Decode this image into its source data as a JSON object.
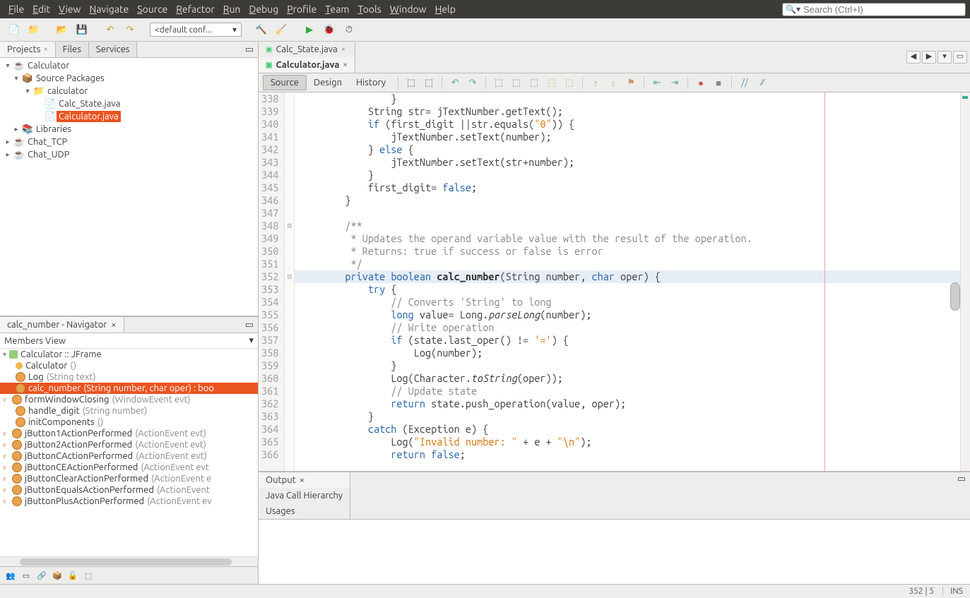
{
  "menubar": [
    "File",
    "Edit",
    "View",
    "Navigate",
    "Source",
    "Refactor",
    "Run",
    "Debug",
    "Profile",
    "Team",
    "Tools",
    "Window",
    "Help"
  ],
  "search_placeholder": "Search (Ctrl+I)",
  "config_select": "<default conf...",
  "left_tabs": [
    {
      "label": "Projects",
      "active": true,
      "close": true
    },
    {
      "label": "Files",
      "active": false,
      "close": false
    },
    {
      "label": "Services",
      "active": false,
      "close": false
    }
  ],
  "projects_tree": [
    {
      "indent": 0,
      "exp": "▾",
      "icon": "☕",
      "label": "Calculator"
    },
    {
      "indent": 1,
      "exp": "▾",
      "icon": "📦",
      "label": "Source Packages"
    },
    {
      "indent": 2,
      "exp": "▾",
      "icon": "📁",
      "label": "calculator"
    },
    {
      "indent": 3,
      "exp": "",
      "icon": "📄",
      "label": "Calc_State.java"
    },
    {
      "indent": 3,
      "exp": "",
      "icon": "📄",
      "label": "Calculator.java",
      "selected": true
    },
    {
      "indent": 1,
      "exp": "▸",
      "icon": "📚",
      "label": "Libraries"
    },
    {
      "indent": 0,
      "exp": "▸",
      "icon": "☕",
      "label": "Chat_TCP"
    },
    {
      "indent": 0,
      "exp": "▸",
      "icon": "☕",
      "label": "Chat_UDP"
    }
  ],
  "navigator_title": "calc_number - Navigator",
  "members_view": "Members View",
  "nav_class": "Calculator :: JFrame",
  "nav_items": [
    {
      "icon": "diamond",
      "name": "Calculator",
      "params": "()"
    },
    {
      "icon": "orange",
      "name": "Log",
      "params": "(String text)"
    },
    {
      "icon": "orange",
      "name": "calc_number",
      "params": "(String number, char oper) : boo",
      "selected": true
    },
    {
      "icon": "orange",
      "name": "formWindowClosing",
      "params": "(WindowEvent evt)",
      "e": true
    },
    {
      "icon": "orange",
      "name": "handle_digit",
      "params": "(String number)"
    },
    {
      "icon": "orange",
      "name": "initComponents",
      "params": "()"
    },
    {
      "icon": "orange",
      "name": "jButton1ActionPerformed",
      "params": "(ActionEvent evt)",
      "e": true
    },
    {
      "icon": "orange",
      "name": "jButton2ActionPerformed",
      "params": "(ActionEvent evt)",
      "e": true
    },
    {
      "icon": "orange",
      "name": "jButtonCActionPerformed",
      "params": "(ActionEvent evt)",
      "e": true
    },
    {
      "icon": "orange",
      "name": "jButtonCEActionPerformed",
      "params": "(ActionEvent evt",
      "e": true
    },
    {
      "icon": "orange",
      "name": "jButtonClearActionPerformed",
      "params": "(ActionEvent e",
      "e": true
    },
    {
      "icon": "orange",
      "name": "jButtonEqualsActionPerformed",
      "params": "(ActionEvent",
      "e": true
    },
    {
      "icon": "orange",
      "name": "jButtonPlusActionPerformed",
      "params": "(ActionEvent ev",
      "e": true
    }
  ],
  "editor_tabs": [
    {
      "label": "Calc_State.java",
      "active": false
    },
    {
      "label": "Calculator.java",
      "active": true
    }
  ],
  "view_buttons": [
    {
      "label": "Source",
      "active": true
    },
    {
      "label": "Design",
      "active": false
    },
    {
      "label": "History",
      "active": false
    }
  ],
  "code_start": 338,
  "code_lines": [
    {
      "html": "                }"
    },
    {
      "html": "            String str= jTextNumber.getText();"
    },
    {
      "html": "            <span class='kw'>if</span> (first_digit ||str.equals(<span class='str'>\"0\"</span>)) {"
    },
    {
      "html": "                jTextNumber.setText(number);"
    },
    {
      "html": "            } <span class='kw'>else</span> {"
    },
    {
      "html": "                jTextNumber.setText(str+number);"
    },
    {
      "html": "            }"
    },
    {
      "html": "            first_digit= <span class='kw'>false</span>;"
    },
    {
      "html": "        }"
    },
    {
      "html": ""
    },
    {
      "html": "        <span class='doc'>/**</span>",
      "fold": "⊟"
    },
    {
      "html": "<span class='doc'>         * Updates the operand variable value with the result of the operation.</span>"
    },
    {
      "html": "<span class='doc'>         * Returns: true if success or false is error</span>"
    },
    {
      "html": "<span class='doc'>         */</span>"
    },
    {
      "html": "        <span class='kw'>private</span> <span class='kw'>boolean</span> <span class='method'>calc_number</span>(String number, <span class='kw'>char</span> oper) {",
      "hl": true,
      "fold": "⊟"
    },
    {
      "html": "            <span class='kw'>try</span> {"
    },
    {
      "html": "                <span class='comment'>// Converts 'String' to long</span>"
    },
    {
      "html": "                <span class='kw'>long</span> value= Long.<span class='method-i'>parseLong</span>(number);"
    },
    {
      "html": "                <span class='comment'>// Write operation</span>"
    },
    {
      "html": "                <span class='kw'>if</span> (state.last_oper() != <span class='str'>'='</span>) {"
    },
    {
      "html": "                    Log(number);"
    },
    {
      "html": "                }"
    },
    {
      "html": "                Log(Character.<span class='method-i'>toString</span>(oper));"
    },
    {
      "html": "                <span class='comment'>// Update state</span>"
    },
    {
      "html": "                <span class='kw'>return</span> state.push_operation(value, oper);"
    },
    {
      "html": "            }"
    },
    {
      "html": "            <span class='kw'>catch</span> (Exception e) {"
    },
    {
      "html": "                Log(<span class='str'>\"Invalid number: \"</span> + e + <span class='str'>\"\\n\"</span>);"
    },
    {
      "html": "                <span class='kw'>return</span> <span class='kw'>false</span>;"
    }
  ],
  "output_tabs": [
    {
      "label": "Output",
      "active": true,
      "close": true
    },
    {
      "label": "Java Call Hierarchy",
      "active": false
    },
    {
      "label": "Usages",
      "active": false
    }
  ],
  "status": {
    "pos": "352 | 5",
    "mode": "INS"
  }
}
